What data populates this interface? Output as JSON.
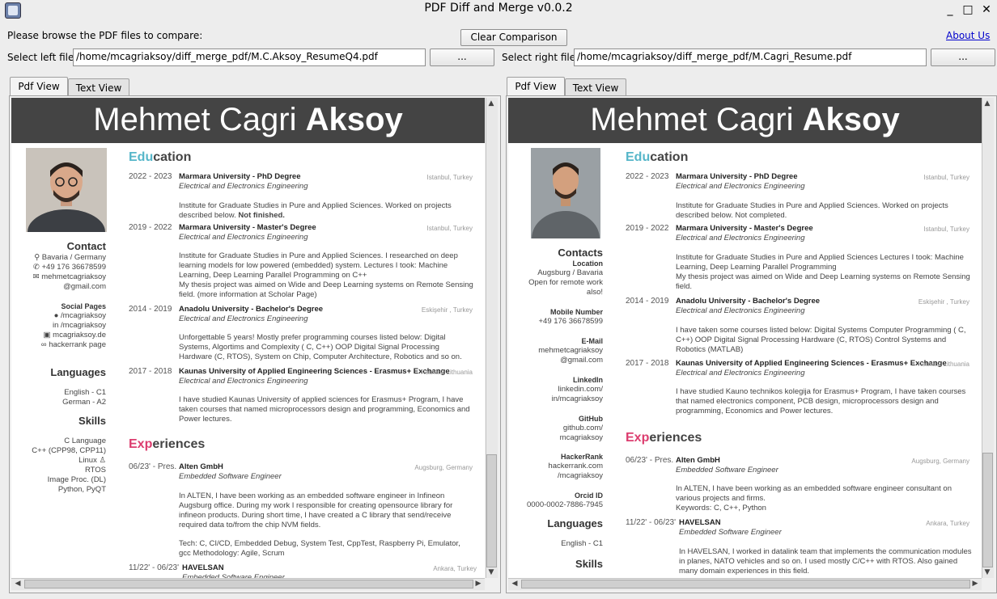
{
  "window": {
    "title": "PDF Diff and Merge v0.0.2",
    "minimize": "_",
    "maximize": "□",
    "close": "✕"
  },
  "toolbar": {
    "browse_prompt": "Please browse the PDF files to compare:",
    "clear_label": "Clear Comparison",
    "about_label": "About Us",
    "left_label": "Select left file:",
    "left_path": "/home/mcagriaksoy/diff_merge_pdf/M.C.Aksoy_ResumeQ4.pdf",
    "right_label": "Select right file:",
    "right_path": "/home/mcagriaksoy/diff_merge_pdf/M.Cagri_Resume.pdf",
    "browse_btn": "..."
  },
  "tabs": {
    "pdf": "Pdf View",
    "text": "Text View"
  },
  "left_doc": {
    "name_light": "Mehmet Cagri",
    "name_bold": "Aksoy",
    "education_hl": "Edu",
    "education_rest": "cation",
    "exp_hl": "Exp",
    "exp_rest": "eriences",
    "contact_title": "Contact",
    "contact": [
      "Bavaria / Germany",
      "+49 176 36678599",
      "mehmetcagriaksoy",
      "@gmail.com"
    ],
    "social_title": "Social Pages",
    "social": [
      "/mcagriaksoy",
      "/mcagriaksoy",
      "mcagriaksoy.de",
      "hackerrank page"
    ],
    "languages_title": "Languages",
    "languages": [
      "English - C1",
      "German - A2"
    ],
    "skills_title": "Skills",
    "skills": [
      "C Language",
      "C++ (CPP98, CPP11)",
      "Linux",
      "RTOS",
      "Image Proc. (DL)",
      "Python, PyQT"
    ],
    "edu": [
      {
        "years": "2022 - 2023",
        "title": "Marmara University - PhD Degree",
        "loc": "Istanbul, Turkey",
        "field": "Electrical and Electronics Engineering",
        "desc": "Institute for Graduate Studies in Pure and Applied Sciences.  Worked on projects described below.",
        "desc_bold": "Not finished."
      },
      {
        "years": "2019 - 2022",
        "title": "Marmara University - Master's Degree",
        "loc": "Istanbul, Turkey",
        "field": "Electrical and Electronics Engineering",
        "desc": "Institute for Graduate Studies in Pure and Applied Sciences.  I researched on deep learning models for low powered (embedded) system.  Lectures I took: Machine Learning, Deep Learning Parallel Programming on C++",
        "desc2": "My thesis project was aimed on Wide and Deep Learning systems on Remote Sensing field. (more information at Scholar Page)"
      },
      {
        "years": "2014 - 2019",
        "title": "Anadolu University - Bachelor's Degree",
        "loc": "Eskişehir , Turkey",
        "field": "Electrical and Electronics Engineering",
        "desc": "Unforgettable 5 years! Mostly prefer programming courses listed below: Digital Systems, Algortims and Complexity ( C, C++) OOP Digital Signal Processing Hardware (C, RTOS), System on Chip, Computer Architecture, Robotics and so on."
      },
      {
        "years": "2017 - 2018",
        "title": "Kaunas University of Applied Engineering Sciences - Erasmus+ Exchange",
        "loc": "Kaunas, Lithuania",
        "field": "Electrical and Electronics Engineering",
        "desc": "I have studied Kaunas University of applied sciences for Erasmus+ Program, I have taken courses that named microprocessors design and programming, Economics and Power lectures."
      }
    ],
    "exp": [
      {
        "years": "06/23' - Pres.",
        "title": "Alten GmbH",
        "loc": "Augsburg, Germany",
        "role": "Embedded Software Engineer",
        "desc": "In ALTEN, I have been working as an embedded software engineer in Infineon Augsburg office.  During my work I responsible for creating opensource library for infineon products.  During short time, I have created a C library that send/receive required data to/from the chip NVM fields.",
        "desc2": "Tech:  C, CI/CD, Embedded Debug, System Test, CppTest, Raspberry Pi, Emulator, gcc Methodology: Agile, Scrum"
      },
      {
        "years": "11/22' - 06/23'",
        "title": "HAVELSAN",
        "loc": "Ankara, Turkey",
        "role": "Embedded Software Engineer"
      }
    ]
  },
  "right_doc": {
    "name_light": "Mehmet Cagri",
    "name_bold": "Aksoy",
    "education_hl": "Edu",
    "education_rest": "cation",
    "exp_hl": "Exp",
    "exp_rest": "eriences",
    "contacts_title": "Contacts",
    "location_title": "Location",
    "location": [
      "Augsburg / Bavaria",
      "Open for remote work",
      "also!"
    ],
    "mobile_title": "Mobile Number",
    "mobile": "+49 176 36678599",
    "email_title": "E-Mail",
    "email": [
      "mehmetcagriaksoy",
      "@gmail.com"
    ],
    "linkedin_title": "LinkedIn",
    "linkedin": [
      "linkedin.com/",
      "in/mcagriaksoy"
    ],
    "github_title": "GitHub",
    "github": [
      "github.com/",
      "mcagriaksoy"
    ],
    "hackerrank_title": "HackerRank",
    "hackerrank": [
      "hackerrank.com",
      "/mcagriaksoy"
    ],
    "orcid_title": "Orcid ID",
    "orcid": "0000-0002-7886-7945",
    "languages_title": "Languages",
    "languages": [
      "English - C1"
    ],
    "skills_title": "Skills",
    "edu": [
      {
        "years": "2022 - 2023",
        "title": "Marmara University - PhD Degree",
        "loc": "Istanbul, Turkey",
        "field": "Electrical and Electronics Engineering",
        "desc": "Institute for Graduate Studies in Pure and Applied Sciences.  Worked on projects described below. Not completed."
      },
      {
        "years": "2019 - 2022",
        "title": "Marmara University - Master's Degree",
        "loc": "Istanbul, Turkey",
        "field": "Electrical and Electronics Engineering",
        "desc": "Institute for Graduate Studies in Pure and Applied Sciences Lectures I took: Machine Learning, Deep Learning Parallel Programming",
        "desc2": "My thesis project was aimed on Wide and Deep Learning systems on Remote Sensing field."
      },
      {
        "years": "2014 - 2019",
        "title": "Anadolu University - Bachelor's Degree",
        "loc": "Eskişehir , Turkey",
        "field": "Electrical and Electronics Engineering",
        "desc": "I have taken some courses listed below: Digital Systems Computer Programming ( C, C++) OOP Digital Signal Processing Hardware (C, RTOS) Control Systems and Robotics (MATLAB)"
      },
      {
        "years": "2017 - 2018",
        "title": "Kaunas University of Applied Engineering Sciences - Erasmus+ Exchange",
        "loc": "Kaunas, Lithuania",
        "field": "Electrical and Electronics Engineering",
        "desc": "I have studied Kauno technikos kolegija for Erasmus+ Program, I have taken courses that named electronics component, PCB design, microprocessors design and programming, Economics and Power lectures."
      }
    ],
    "exp": [
      {
        "years": "06/23' - Pres.",
        "title": "Alten GmbH",
        "loc": "Augsburg, Germany",
        "role": "Embedded Software Engineer",
        "desc": "In ALTEN, I have been working as an embedded software engineer consultant on various projects and firms.",
        "desc2": "Keywords: C, C++, Python"
      },
      {
        "years": "11/22' - 06/23'",
        "title": "HAVELSAN",
        "loc": "Ankara, Turkey",
        "role": "Embedded Software Engineer",
        "desc": "In HAVELSAN, I worked in datalink team that implements the communication modules in planes, NATO vehicles and so on. I used mostly C/C++ with RTOS. Also gained many domain experiences in this field."
      }
    ]
  },
  "scroll": {
    "up": "▲",
    "down": "▼",
    "left": "◀",
    "right": "▶"
  }
}
